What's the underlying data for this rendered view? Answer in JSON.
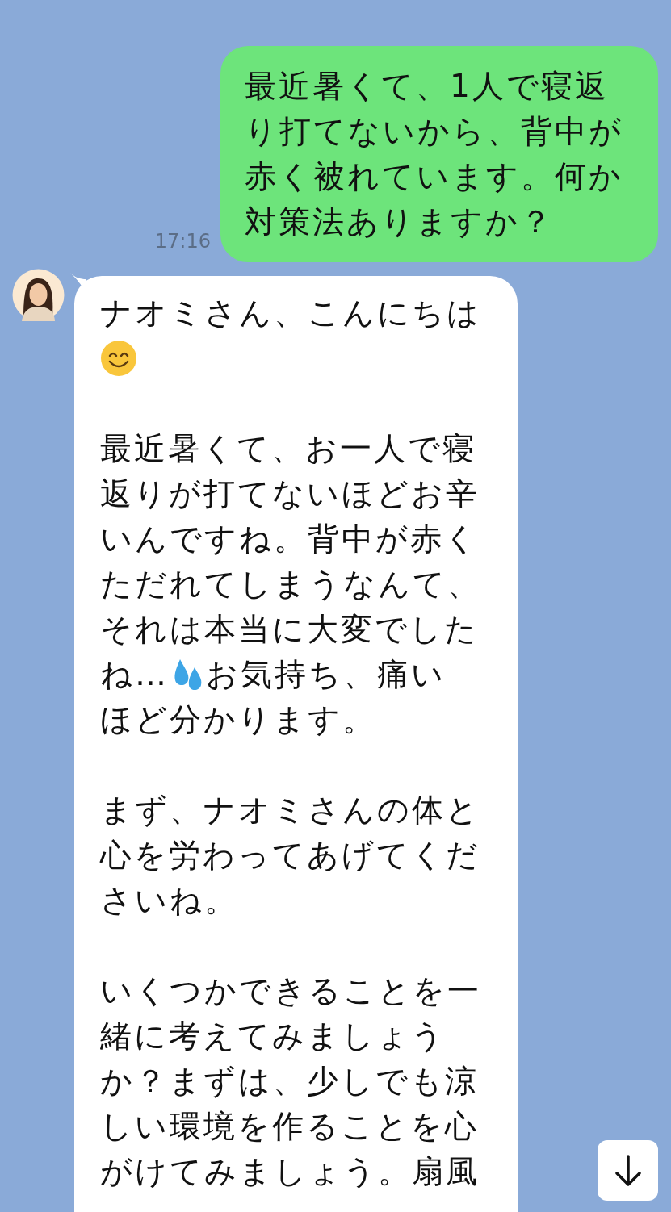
{
  "messages": [
    {
      "kind": "sent",
      "time": "17:16",
      "paragraphs": [
        [
          [
            {
              "kind": "text",
              "text": "最近暑くて、1人で寝返"
            }
          ],
          [
            {
              "kind": "text",
              "text": "り打てないから、背中が"
            }
          ],
          [
            {
              "kind": "text",
              "text": "赤く被れています。何か"
            }
          ],
          [
            {
              "kind": "text",
              "text": "対策法ありますか？"
            }
          ]
        ]
      ]
    },
    {
      "kind": "received",
      "paragraphs": [
        [
          [
            {
              "kind": "text",
              "text": "ナオミさん、こんにちは"
            }
          ],
          [
            {
              "kind": "smile"
            }
          ]
        ],
        [
          [
            {
              "kind": "text",
              "text": "最近暑くて、お一人で寝"
            }
          ],
          [
            {
              "kind": "text",
              "text": "返りが打てないほどお辛"
            }
          ],
          [
            {
              "kind": "text",
              "text": "いんですね。背中が赤く"
            }
          ],
          [
            {
              "kind": "text",
              "text": "ただれてしまうなんて、"
            }
          ],
          [
            {
              "kind": "text",
              "text": "それは本当に大変でした"
            }
          ],
          [
            {
              "kind": "text",
              "text": "ね…"
            },
            {
              "kind": "droplets"
            },
            {
              "kind": "text",
              "text": " お気持ち、痛い"
            }
          ],
          [
            {
              "kind": "text",
              "text": "ほど分かります。"
            }
          ]
        ],
        [
          [
            {
              "kind": "text",
              "text": "まず、ナオミさんの体と"
            }
          ],
          [
            {
              "kind": "text",
              "text": "心を労わってあげてくだ"
            }
          ],
          [
            {
              "kind": "text",
              "text": "さいね。"
            }
          ]
        ],
        [
          [
            {
              "kind": "text",
              "text": "いくつかできることを一"
            }
          ],
          [
            {
              "kind": "text",
              "text": "緒に考えてみましょう"
            }
          ],
          [
            {
              "kind": "text",
              "text": "か？まずは、少しでも涼"
            }
          ],
          [
            {
              "kind": "text",
              "text": "しい環境を作ることを心"
            }
          ],
          [
            {
              "kind": "text",
              "text": "がけてみましょう。扇風"
            }
          ]
        ]
      ]
    }
  ]
}
